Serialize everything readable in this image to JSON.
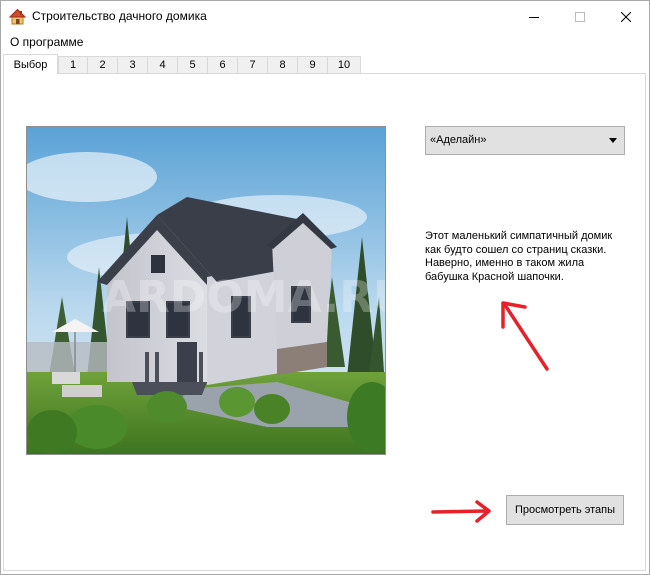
{
  "window": {
    "title": "Строительство дачного домика"
  },
  "menu": {
    "about": "О программе"
  },
  "tabs": [
    {
      "label": "Выбор"
    },
    {
      "label": "1"
    },
    {
      "label": "2"
    },
    {
      "label": "3"
    },
    {
      "label": "4"
    },
    {
      "label": "5"
    },
    {
      "label": "6"
    },
    {
      "label": "7"
    },
    {
      "label": "8"
    },
    {
      "label": "9"
    },
    {
      "label": "10"
    }
  ],
  "main": {
    "house_select": {
      "selected": "«Аделайн»"
    },
    "description": "Этот маленький симпатичный домик как будто сошел со страниц сказки. Наверно, именно в таком жила бабушка Красной шапочки.",
    "view_stages_button": "Просмотреть этапы",
    "watermark": "ARDOMA.RU"
  },
  "colors": {
    "annotation_arrow": "#e8202a",
    "button_face": "#e1e1e1",
    "tab_inactive": "#f0f0f0"
  },
  "icons": {
    "app": "house-icon",
    "minimize": "minimize-icon",
    "maximize": "maximize-icon",
    "close": "close-icon"
  }
}
